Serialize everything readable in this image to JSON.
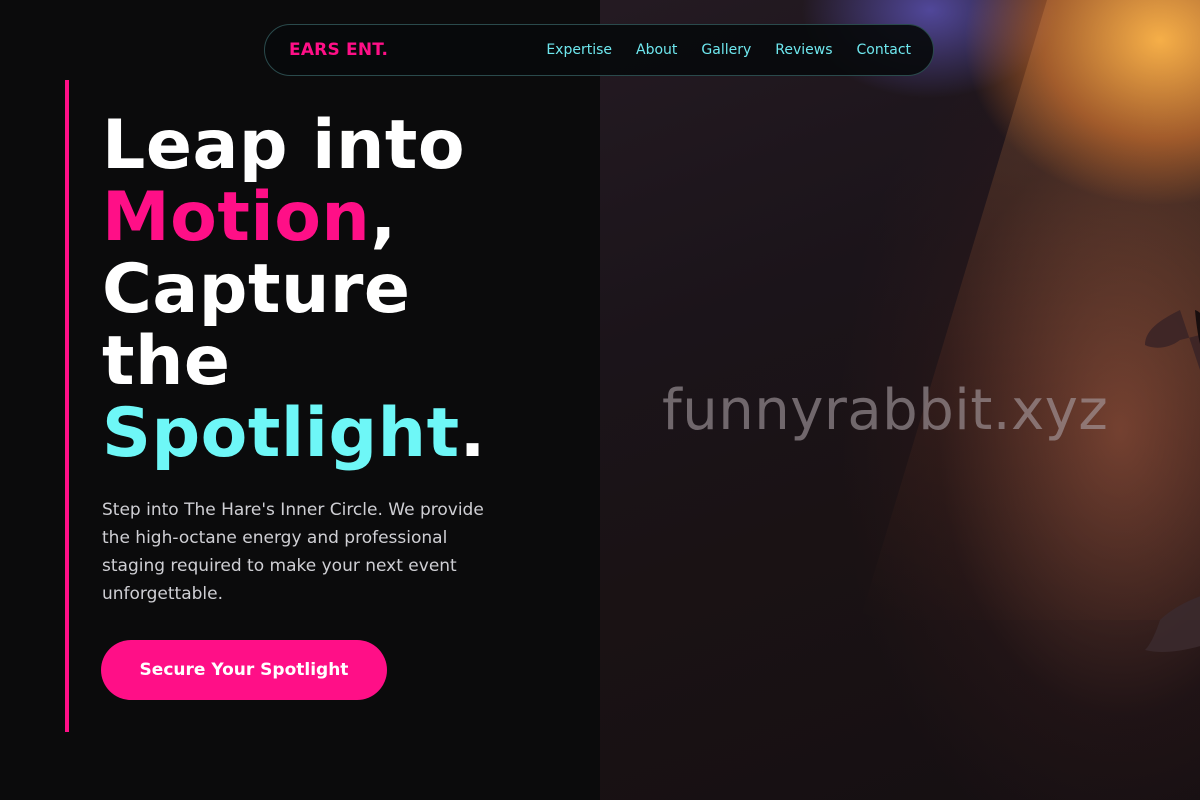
{
  "nav": {
    "brand": "EARS ENT.",
    "links": [
      "Expertise",
      "About",
      "Gallery",
      "Reviews",
      "Contact"
    ]
  },
  "hero": {
    "headline": {
      "line1": "Leap into",
      "line2_highlight": "Motion",
      "line2_punct": ",",
      "line3": "Capture",
      "line4": "the",
      "line5_highlight": "Spotlight",
      "line5_punct": "."
    },
    "description": "Step into The Hare's Inner Circle. We provide the high-octane energy and professional staging required to make your next event unforgettable.",
    "cta_label": "Secure Your Spotlight",
    "image_watermark": "funnyrabbit.xyz"
  },
  "colors": {
    "accent_pink": "#ff0f87",
    "accent_cyan": "#6ef7f7",
    "background": "#0b0b0c",
    "nav_link": "#6ee7ee"
  }
}
